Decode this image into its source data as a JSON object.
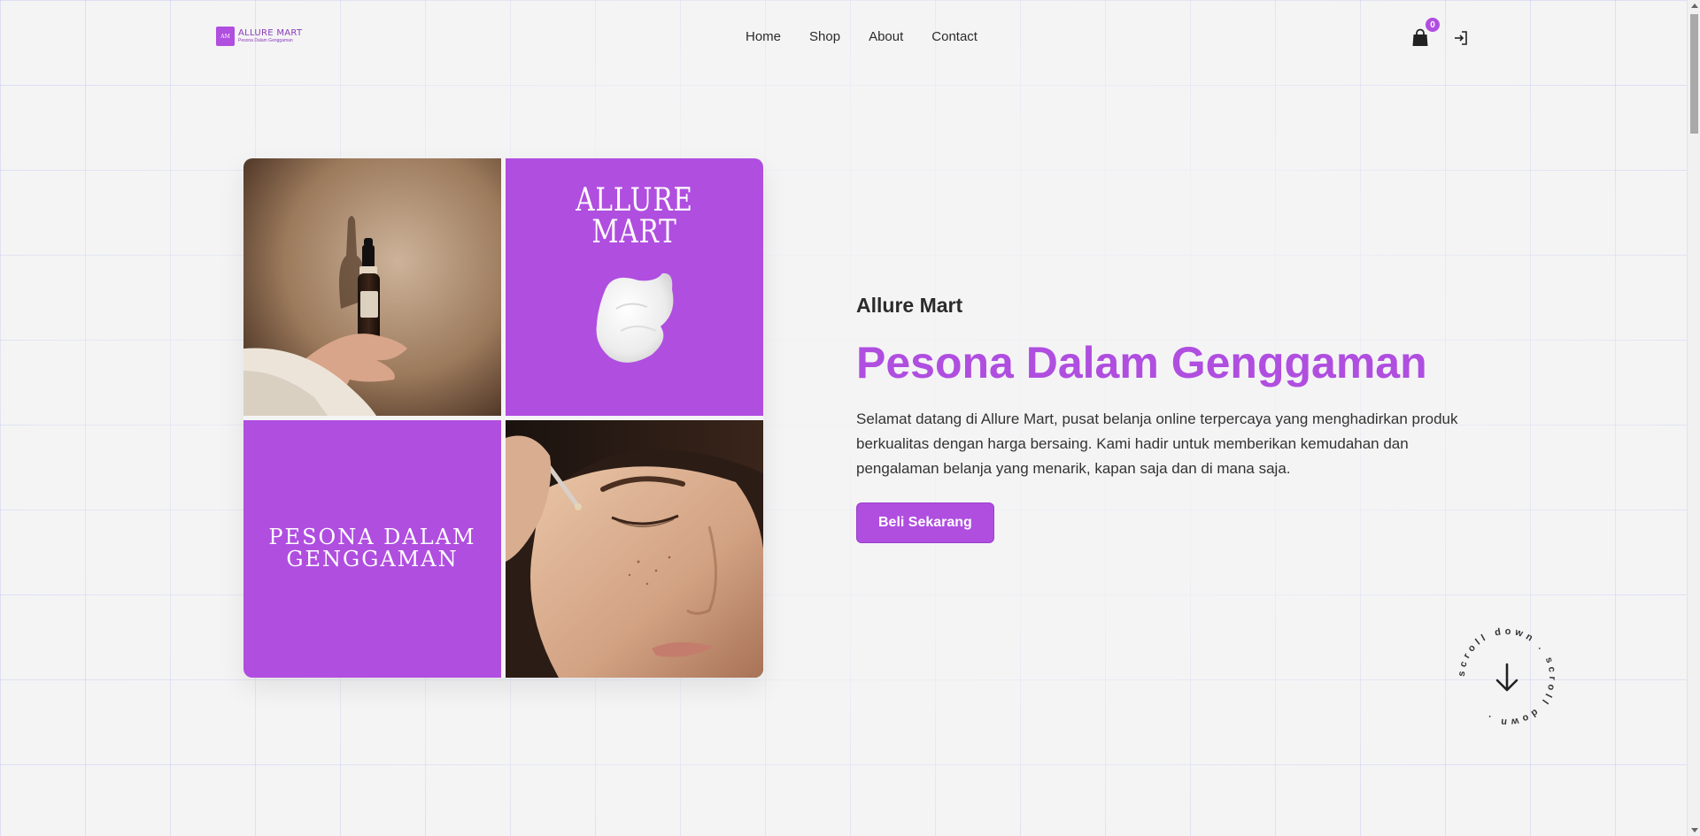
{
  "header": {
    "logo": {
      "mark": "AM",
      "name": "ALLURE MART",
      "tagline": "Pesona Dalam Genggaman"
    },
    "nav": [
      {
        "label": "Home"
      },
      {
        "label": "Shop"
      },
      {
        "label": "About"
      },
      {
        "label": "Contact"
      }
    ],
    "cart_count": "0",
    "icons": {
      "cart": "shopping-bag-icon",
      "login": "login-icon"
    }
  },
  "hero": {
    "images": {
      "top_right": {
        "title_line1": "ALLURE",
        "title_line2": "MART"
      },
      "bottom_left": {
        "title_line1": "PESONA DALAM",
        "title_line2": "GENGGAMAN"
      }
    },
    "brand": "Allure Mart",
    "headline": "Pesona Dalam Genggaman",
    "description": "Selamat datang di Allure Mart, pusat belanja online terpercaya yang menghadirkan produk berkualitas dengan harga bersaing. Kami hadir untuk memberikan kemudahan dan pengalaman belanja yang menarik, kapan saja dan di mana saja.",
    "cta_label": "Beli Sekarang"
  },
  "scroll_indicator": {
    "text": "scroll down . scroll down . "
  },
  "colors": {
    "accent": "#b04ee0",
    "background": "#f4f4f5",
    "text": "#2b2b2b"
  }
}
